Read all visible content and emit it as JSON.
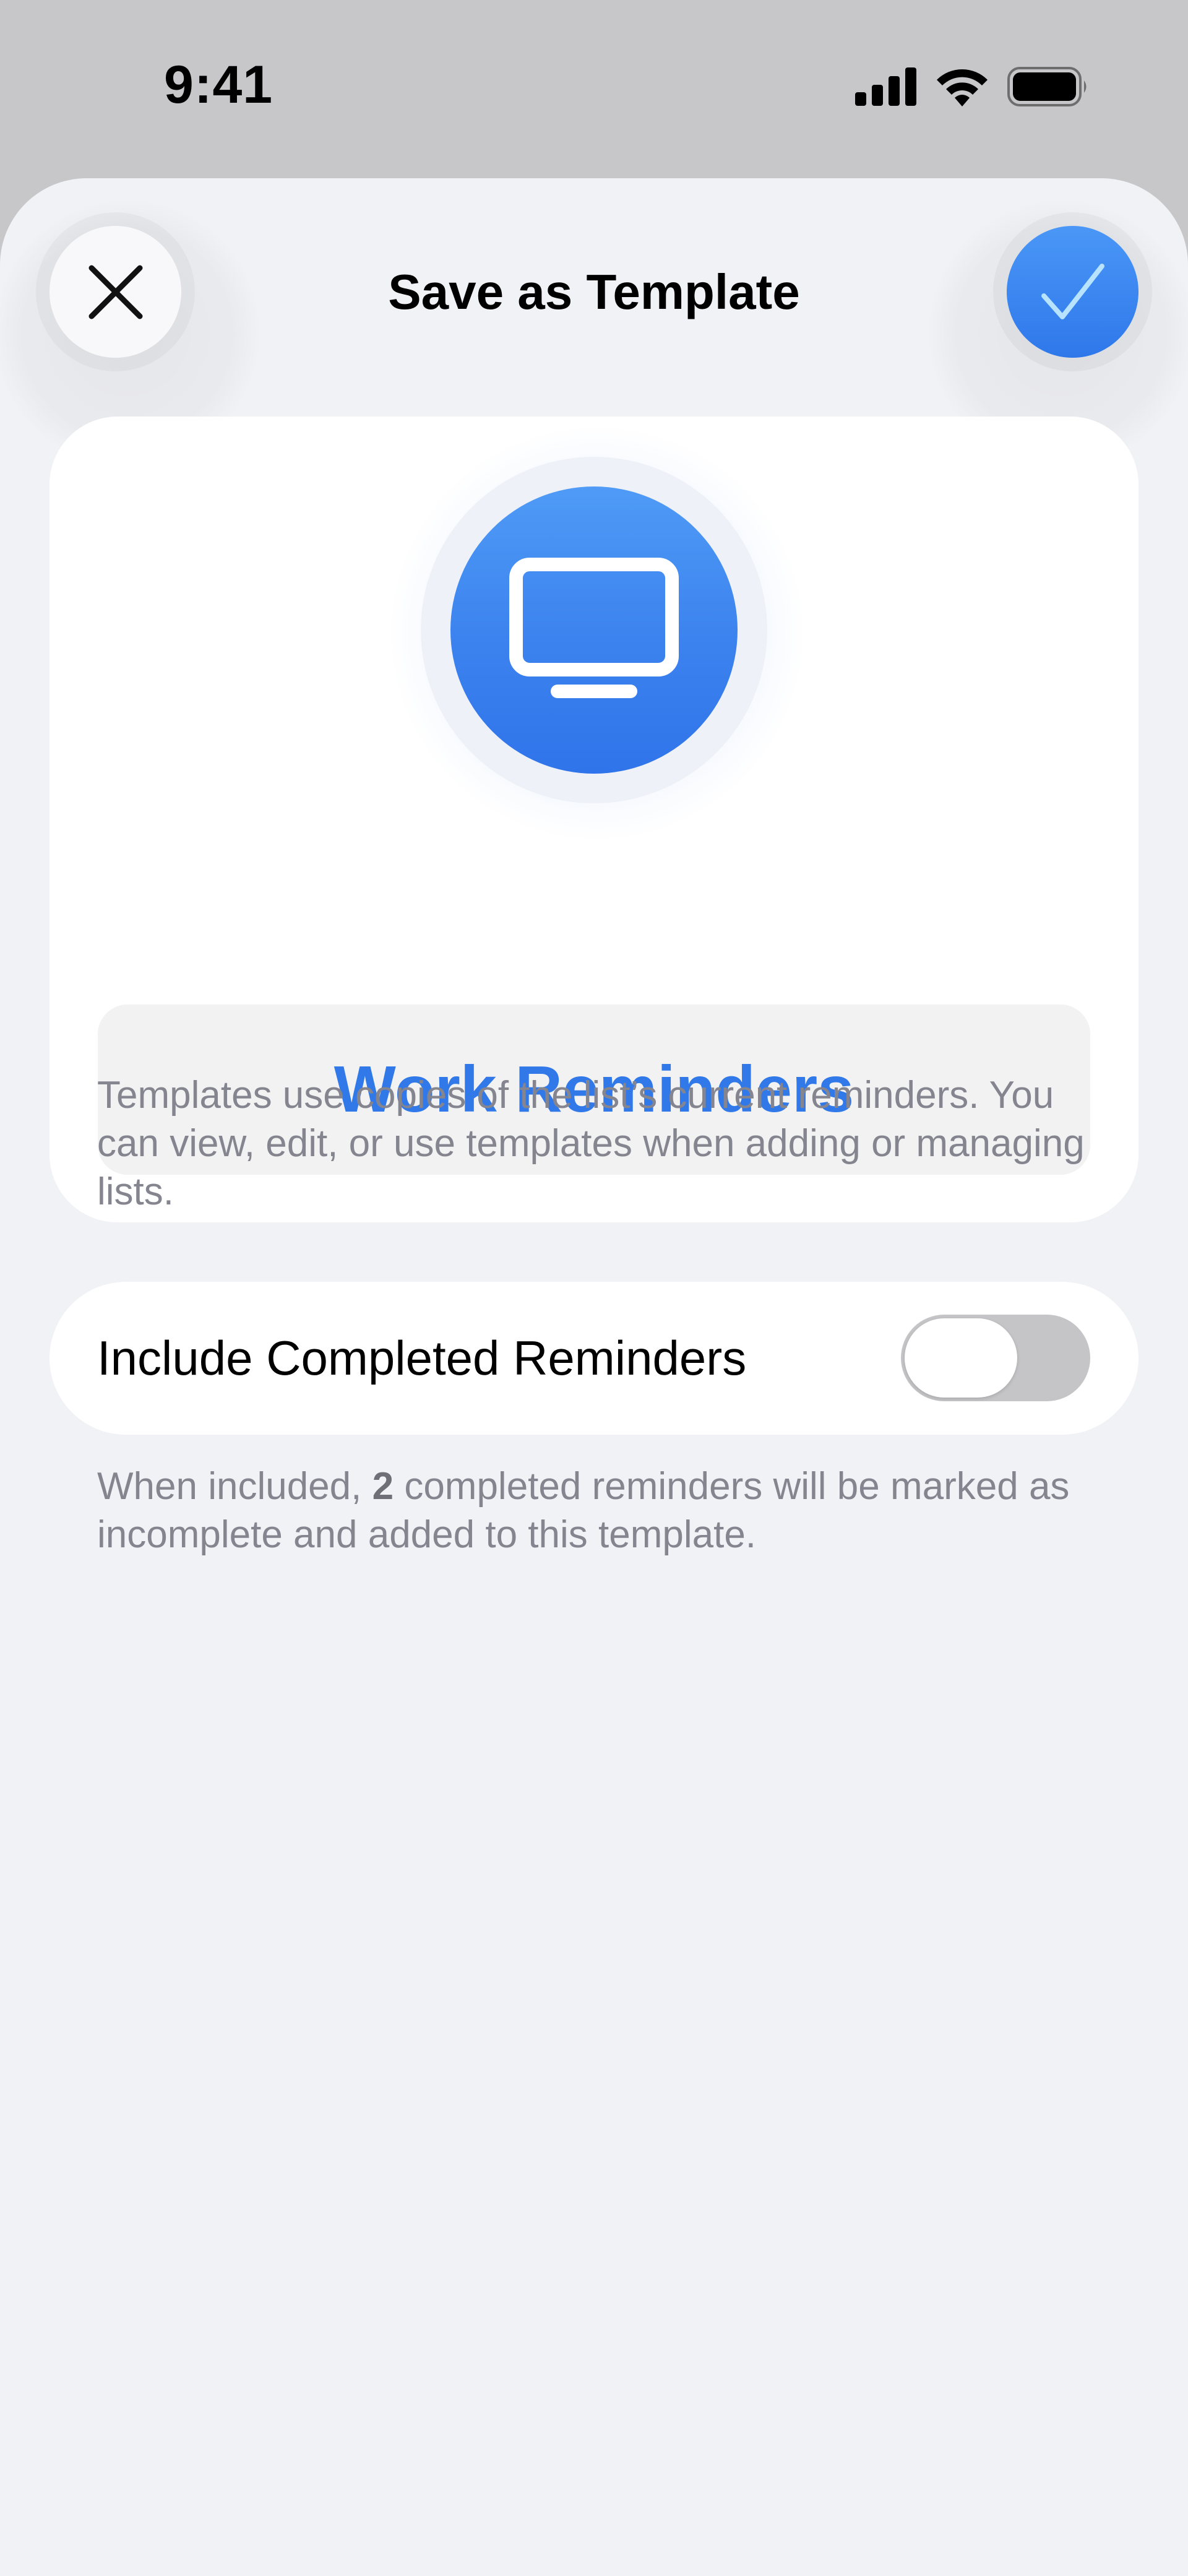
{
  "status_bar": {
    "time": "9:41",
    "icons": [
      "cellular-signal-icon",
      "wifi-icon",
      "battery-icon"
    ]
  },
  "header": {
    "title": "Save as Template",
    "close_icon": "close-icon",
    "confirm_icon": "checkmark-icon"
  },
  "list": {
    "icon": "desktop-computer-icon",
    "name": "Work Reminders",
    "accent_color": "#3179e8"
  },
  "description": "Templates use copies of the list’s current reminders. You can view, edit, or use templates when adding or managing lists.",
  "include_completed": {
    "label": "Include Completed Reminders",
    "enabled": false
  },
  "completed_note": {
    "prefix": "When included, ",
    "count": "2",
    "suffix": " completed reminders will be marked as incomplete and added to this template."
  }
}
